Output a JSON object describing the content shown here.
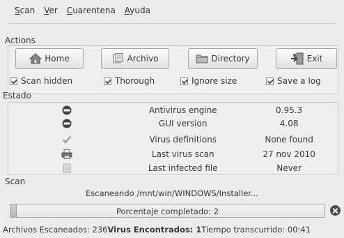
{
  "menu": [
    {
      "label": "Scan",
      "underline": "S",
      "rest": "can"
    },
    {
      "label": "Ver",
      "underline": "V",
      "rest": "er"
    },
    {
      "label": "Cuarentena",
      "underline": "C",
      "rest": "uarentena"
    },
    {
      "label": "Ayuda",
      "underline": "A",
      "rest": "yuda"
    }
  ],
  "actions": {
    "title": "Actions",
    "buttons": [
      {
        "label": "Home",
        "icon": "home-icon"
      },
      {
        "label": "Archivo",
        "icon": "file-icon"
      },
      {
        "label": "Directory",
        "icon": "folder-icon"
      },
      {
        "label": "Exit",
        "icon": "exit-icon"
      }
    ],
    "options": [
      {
        "label": "Scan hidden",
        "checked": true
      },
      {
        "label": "Thorough",
        "checked": true
      },
      {
        "label": "Ignore size",
        "checked": true
      },
      {
        "label": "Save a log",
        "checked": true
      }
    ]
  },
  "estado": {
    "title": "Estado",
    "rows": [
      {
        "icon": "minus-circle-icon",
        "label": "Antivirus engine",
        "value": "0.95.3"
      },
      {
        "icon": "minus-circle-icon",
        "label": "GUI version",
        "value": "4.08"
      },
      {
        "icon": "checkmark-icon",
        "label": "Virus definitions",
        "value": "None found"
      },
      {
        "icon": "printer-icon",
        "label": "Last virus scan",
        "value": "27 nov 2010"
      },
      {
        "icon": "document-icon",
        "label": "Last infected file",
        "value": "Never"
      }
    ]
  },
  "scan": {
    "title": "Scan",
    "current": "Escaneando /mnt/win/WINDOWS/Installer...",
    "progress_text": "Porcentaje completado:  2",
    "progress_value": 0.02
  },
  "status": {
    "files_label": "Archivos Escaneados: 236",
    "virus_label": "Virus Encontrados: 1",
    "time_label": "Tiempo transcurrido: 00:41"
  }
}
